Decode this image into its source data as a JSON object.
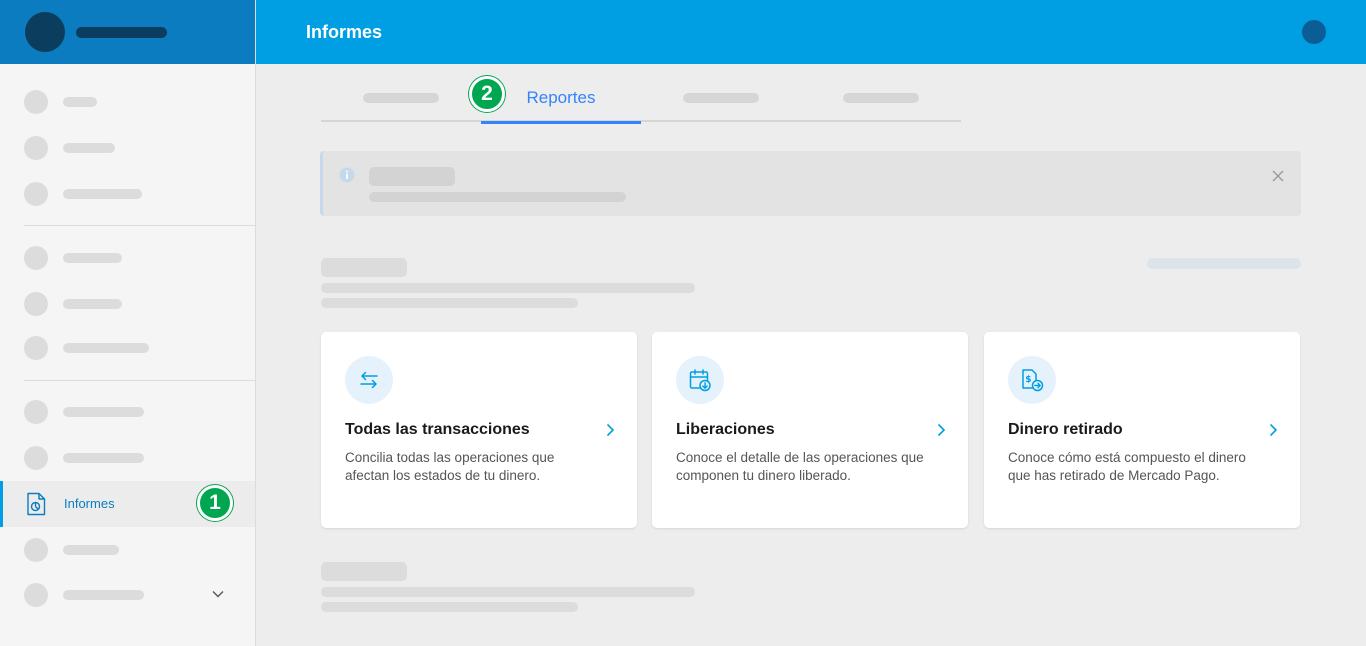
{
  "header": {
    "title": "Informes"
  },
  "sidebar": {
    "active_item": {
      "label": "Informes",
      "icon": "report-document-icon"
    },
    "badge": "1"
  },
  "tabs": {
    "active_label": "Reportes",
    "badge": "2"
  },
  "cards": [
    {
      "title": "Todas las transacciones",
      "description": "Concilia todas las operaciones que afectan los estados de tu dinero.",
      "icon": "transfer-arrows-icon"
    },
    {
      "title": "Liberaciones",
      "description": "Conoce el detalle de las operaciones que componen tu dinero liberado.",
      "icon": "calendar-download-icon"
    },
    {
      "title": "Dinero retirado",
      "description": "Conoce cómo está compuesto el dinero que has retirado de Mercado Pago.",
      "icon": "money-document-icon"
    }
  ],
  "colors": {
    "brand_blue": "#009ee3",
    "sidebar_header": "#0a7cbf",
    "tab_active": "#3483fa",
    "badge_green": "#00a650"
  }
}
